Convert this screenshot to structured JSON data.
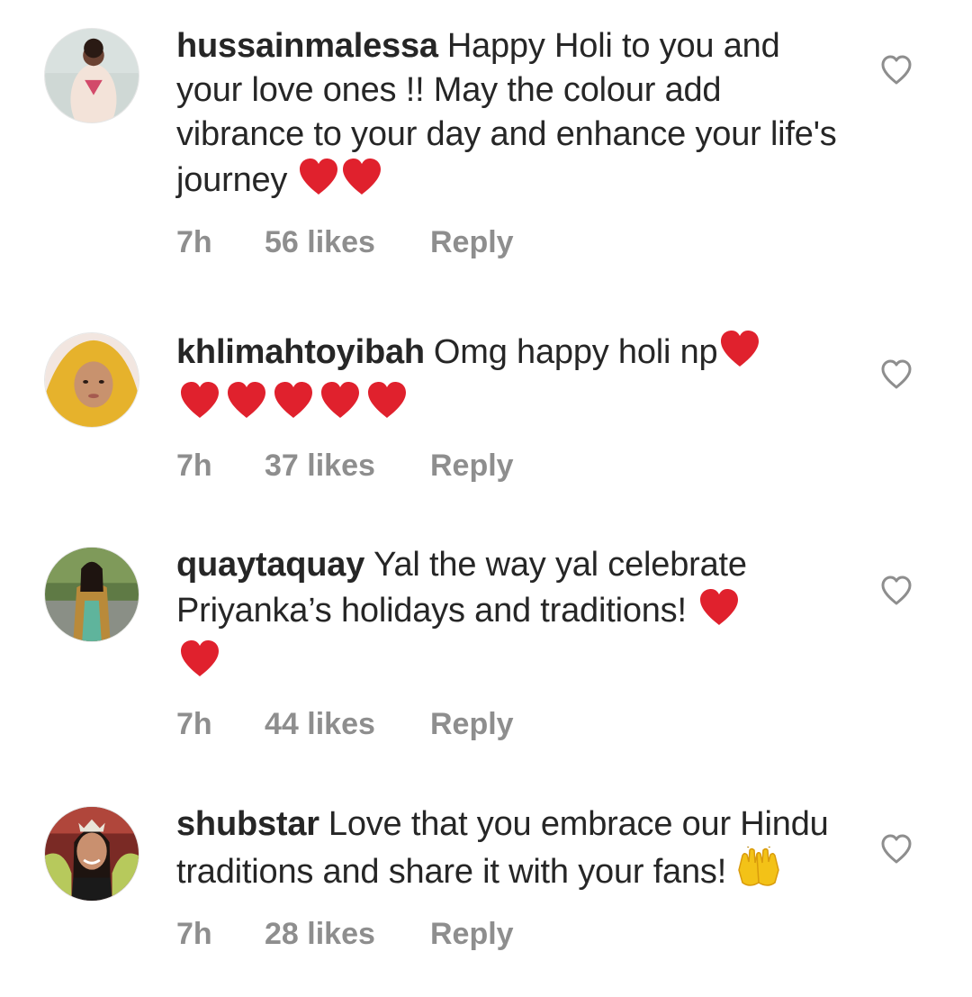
{
  "comments": [
    {
      "username": "hussainmalessa",
      "text": "Happy Holi to you and your love ones !! May the colour add vibrance to your day and enhance your life's journey",
      "emojis": [
        "❤️",
        "❤️"
      ],
      "time": "7h",
      "likes": "56 likes",
      "reply": "Reply",
      "avatar_colors": [
        "#cfd8d5",
        "#f3e3d9",
        "#6b4233"
      ]
    },
    {
      "username": "khlimahtoyibah",
      "text": "Omg happy holi np",
      "emojis": [
        "❤️",
        "❤️",
        "❤️",
        "❤️",
        "❤️",
        "❤️"
      ],
      "time": "7h",
      "likes": "37 likes",
      "reply": "Reply",
      "avatar_colors": [
        "#f2e6e0",
        "#e6b22c",
        "#c8926e"
      ]
    },
    {
      "username": "quaytaquay",
      "text": "Yal the way yal celebrate Priyanka’s holidays and traditions!",
      "emojis": [
        "❤️",
        "❤️"
      ],
      "time": "7h",
      "likes": "44 likes",
      "reply": "Reply",
      "avatar_colors": [
        "#5f7a45",
        "#b98a3a",
        "#4a2f22"
      ]
    },
    {
      "username": "shubstar",
      "text": "Love that you embrace our Hindu traditions and share it with your fans!",
      "emojis": [
        "🙌"
      ],
      "time": "7h",
      "likes": "28 likes",
      "reply": "Reply",
      "avatar_colors": [
        "#7a2a25",
        "#b7c95c",
        "#c9906f"
      ]
    }
  ],
  "colors": {
    "text": "#262626",
    "muted": "#8e8e8e",
    "heart_red": "#e0212d"
  }
}
